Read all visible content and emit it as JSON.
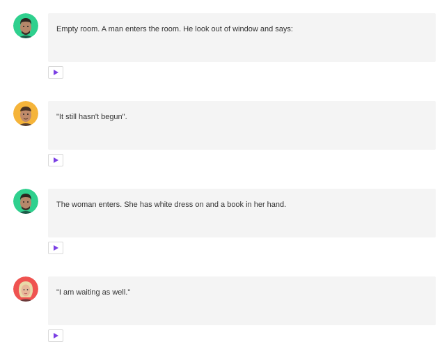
{
  "entries": [
    {
      "avatar_icon": "man-dark-hair-avatar",
      "avatar_bg": "#2fd08e",
      "text": "Empty room. A man enters the room. He look out of window and says:",
      "play_icon": "play-icon"
    },
    {
      "avatar_icon": "man-short-hair-avatar",
      "avatar_bg": "#f5b43a",
      "text": "\"It still hasn't begun\".",
      "play_icon": "play-icon"
    },
    {
      "avatar_icon": "man-dark-hair-avatar",
      "avatar_bg": "#2fd08e",
      "text": "The woman enters. She has white dress on and a book in her hand.",
      "play_icon": "play-icon"
    },
    {
      "avatar_icon": "woman-blonde-hair-avatar",
      "avatar_bg": "#ef5350",
      "text": "\"I am waiting as well.\"",
      "play_icon": "play-icon"
    }
  ],
  "colors": {
    "play_accent": "#7b3fe4",
    "bubble_bg": "#f4f4f4"
  }
}
